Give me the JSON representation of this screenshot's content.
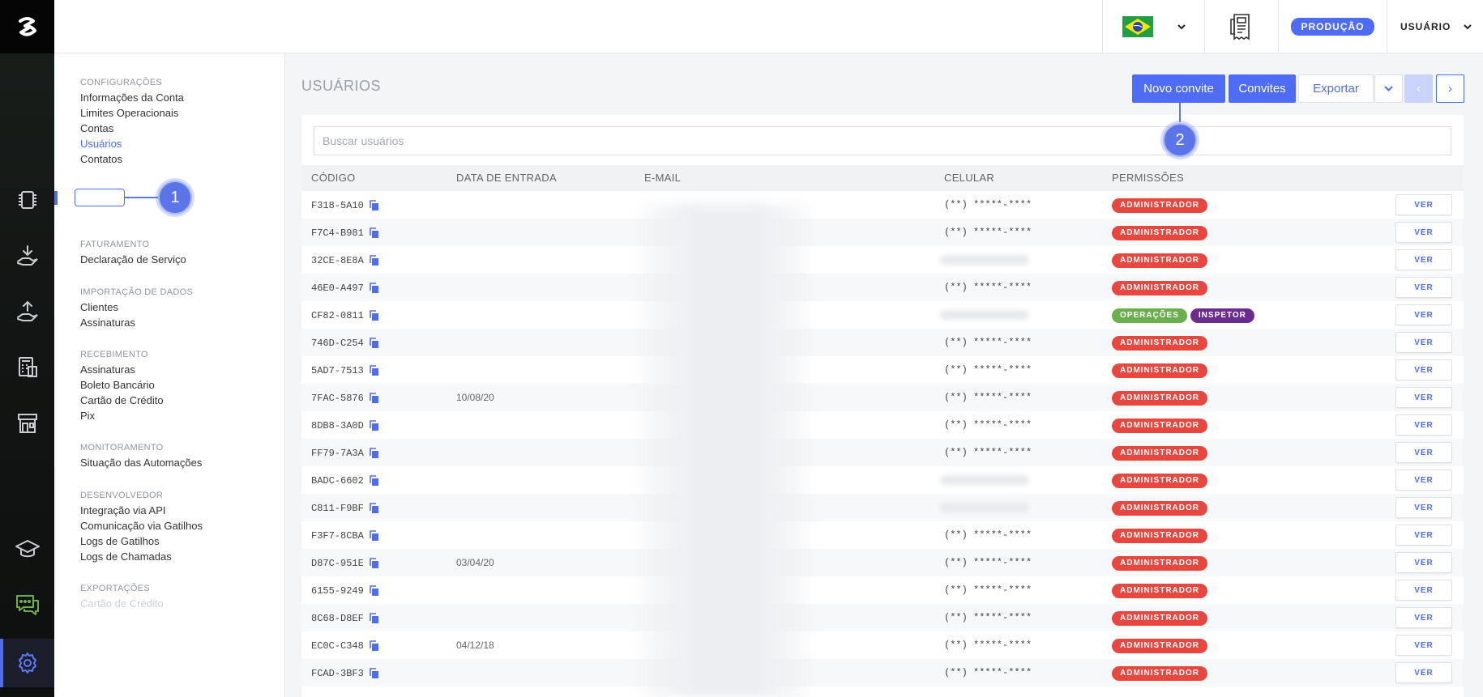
{
  "top_bar": {
    "environment_badge": "PRODUÇÃO",
    "user_menu_label": "USUÁRIO"
  },
  "colors": {
    "accent": "#4f6cf7",
    "admin": "#e8473f",
    "operacoes": "#6ab04c",
    "inspetor": "#6a2c8e"
  },
  "settings_menu": [
    {
      "title": "CONFIGURAÇÕES",
      "items": [
        "Informações da Conta",
        "Limites Operacionais",
        "Contas",
        "Usuários",
        "Contatos"
      ]
    },
    {
      "title": "FATURAMENTO",
      "items": [
        "Declaração de Serviço"
      ]
    },
    {
      "title": "IMPORTAÇÃO DE DADOS",
      "items": [
        "Clientes",
        "Assinaturas"
      ]
    },
    {
      "title": "RECEBIMENTO",
      "items": [
        "Assinaturas",
        "Boleto Bancário",
        "Cartão de Crédito",
        "Pix"
      ]
    },
    {
      "title": "MONITORAMENTO",
      "items": [
        "Situação das Automações"
      ]
    },
    {
      "title": "DESENVOLVEDOR",
      "items": [
        "Integração via API",
        "Comunicação via Gatilhos",
        "Logs de Gatilhos",
        "Logs de Chamadas"
      ]
    },
    {
      "title": "EXPORTAÇÕES",
      "items": [
        "Cartão de Crédito"
      ]
    }
  ],
  "callouts": [
    "1",
    "2"
  ],
  "page": {
    "title": "USUÁRIOS",
    "buttons": {
      "new_invite": "Novo convite",
      "invites": "Convites",
      "export": "Exportar",
      "prev": "‹",
      "next": "›"
    },
    "search_placeholder": "Buscar usuários"
  },
  "table": {
    "columns": [
      "CÓDIGO",
      "DATA DE ENTRADA",
      "E-MAIL",
      "CELULAR",
      "PERMISSÕES"
    ],
    "action_label": "VER",
    "rows": [
      {
        "code": "F318-5A10",
        "date": "",
        "phone": "(**) *****-****",
        "perms": [
          "ADMINISTRADOR"
        ]
      },
      {
        "code": "F7C4-B981",
        "date": "",
        "phone": "(**) *****-****",
        "perms": [
          "ADMINISTRADOR"
        ]
      },
      {
        "code": "32CE-8E8A",
        "date": "",
        "phone": "",
        "perms": [
          "ADMINISTRADOR"
        ]
      },
      {
        "code": "46E0-A497",
        "date": "",
        "phone": "(**) *****-****",
        "perms": [
          "ADMINISTRADOR"
        ]
      },
      {
        "code": "CF82-0811",
        "date": "",
        "phone": "",
        "perms": [
          "OPERAÇÕES",
          "INSPETOR"
        ]
      },
      {
        "code": "746D-C254",
        "date": "",
        "phone": "(**) *****-****",
        "perms": [
          "ADMINISTRADOR"
        ]
      },
      {
        "code": "5AD7-7513",
        "date": "",
        "phone": "(**) *****-****",
        "perms": [
          "ADMINISTRADOR"
        ]
      },
      {
        "code": "7FAC-5876",
        "date": "10/08/20",
        "phone": "(**) *****-****",
        "perms": [
          "ADMINISTRADOR"
        ]
      },
      {
        "code": "8DB8-3A0D",
        "date": "",
        "phone": "(**) *****-****",
        "perms": [
          "ADMINISTRADOR"
        ]
      },
      {
        "code": "FF79-7A3A",
        "date": "",
        "phone": "(**) *****-****",
        "perms": [
          "ADMINISTRADOR"
        ]
      },
      {
        "code": "BADC-6602",
        "date": "",
        "phone": "",
        "perms": [
          "ADMINISTRADOR"
        ]
      },
      {
        "code": "C811-F9BF",
        "date": "",
        "phone": "",
        "perms": [
          "ADMINISTRADOR"
        ]
      },
      {
        "code": "F3F7-8CBA",
        "date": "",
        "phone": "(**) *****-****",
        "perms": [
          "ADMINISTRADOR"
        ]
      },
      {
        "code": "D87C-951E",
        "date": "03/04/20",
        "phone": "(**) *****-****",
        "perms": [
          "ADMINISTRADOR"
        ]
      },
      {
        "code": "6155-9249",
        "date": "",
        "phone": "(**) *****-****",
        "perms": [
          "ADMINISTRADOR"
        ]
      },
      {
        "code": "8C68-D8EF",
        "date": "",
        "phone": "(**) *****-****",
        "perms": [
          "ADMINISTRADOR"
        ]
      },
      {
        "code": "EC0C-C348",
        "date": "04/12/18",
        "phone": "(**) *****-****",
        "perms": [
          "ADMINISTRADOR"
        ]
      },
      {
        "code": "FCAD-3BF3",
        "date": "",
        "phone": "(**) *****-****",
        "perms": [
          "ADMINISTRADOR"
        ]
      }
    ]
  },
  "rail_icons": [
    "chip-icon",
    "download-hand-icon",
    "upload-hand-icon",
    "calculator-icon",
    "store-icon",
    "graduation-cap-icon",
    "chat-icon",
    "gear-icon"
  ]
}
